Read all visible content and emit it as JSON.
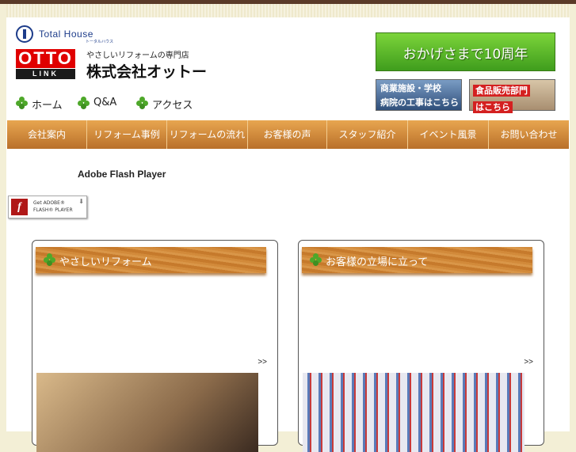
{
  "logo": {
    "brand": "Total House",
    "brand_kana": "トータルハウス",
    "otto": "OTTO",
    "link": "LINK",
    "tagline": "やさしいリフォームの専門店",
    "company": "株式会社オットー"
  },
  "banners": {
    "anniversary": "おかげさまで10周年",
    "commercial_line1": "商業施設・学校",
    "commercial_line2": "病院の工事はこちら",
    "food_line1": "食品販売部門",
    "food_line2": "はこちら"
  },
  "subnav": [
    {
      "label": "ホーム"
    },
    {
      "label": "Q&A"
    },
    {
      "label": "アクセス"
    }
  ],
  "mainnav": [
    {
      "label": "会社案内"
    },
    {
      "label": "リフォーム事例"
    },
    {
      "label": "リフォームの流れ"
    },
    {
      "label": "お客様の声"
    },
    {
      "label": "スタッフ紹介"
    },
    {
      "label": "イベント風景"
    },
    {
      "label": "お問い合わせ"
    }
  ],
  "flash": {
    "title": "Adobe Flash Player",
    "get_line1": "Get ADOBE®",
    "get_line2": "FLASH® PLAYER"
  },
  "panels": [
    {
      "title": "やさしいリフォーム",
      "more": ">>"
    },
    {
      "title": "お客様の立場に立って",
      "more": ">>"
    }
  ],
  "colors": {
    "nav_top": "#e8a650",
    "nav_bottom": "#b9702a",
    "clover": "#4ea82a",
    "anniversary_green": "#5cb82a"
  }
}
